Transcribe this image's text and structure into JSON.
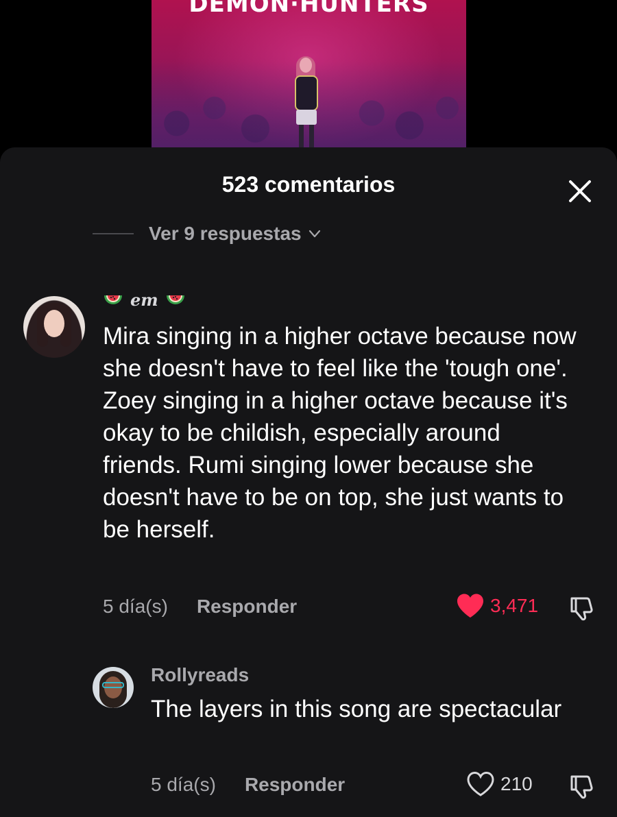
{
  "video": {
    "title": "DEMON·HUNTERS"
  },
  "sheet": {
    "title": "523 comentarios",
    "close_icon": "close-icon"
  },
  "replies_toggle": {
    "label": "Ver 9 respuestas",
    "icon": "chevron-down-icon"
  },
  "comments": [
    {
      "username": "em",
      "username_decoration": "watermelon-icon",
      "text": "Mira singing in a higher octave because now she doesn't have to feel like the 'tough one'. Zoey singing in a higher octave because it's okay to be childish, especially around friends. Rumi singing lower because she doesn't have to be on top, she just wants to be herself.",
      "time": "5 día(s)",
      "reply_label": "Responder",
      "likes": "3,471",
      "liked": true,
      "like_color": "#ff2c55"
    },
    {
      "username": "Rollyreads",
      "text": "The layers in this song are spectacular",
      "time": "5 día(s)",
      "reply_label": "Responder",
      "likes": "210",
      "liked": false
    }
  ],
  "colors": {
    "sheet_background": "#151517",
    "secondary_text": "#a9a9ad",
    "accent_red": "#ff2c55"
  }
}
